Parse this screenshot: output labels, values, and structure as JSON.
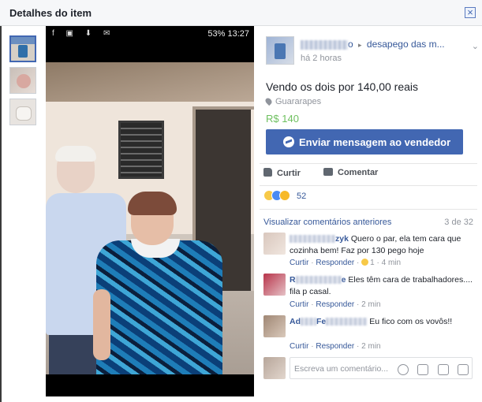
{
  "dialog": {
    "title": "Detalhes do item",
    "close_icon": "close-icon",
    "close_glyph": "×"
  },
  "photo": {
    "status_bar": {
      "left_icons": "f ▣ ⬇ ✉",
      "right": "53% 13:27"
    }
  },
  "seller": {
    "name_suffix": "o",
    "arrow": "▸",
    "group": "desapego das m...",
    "time": "há 2 horas"
  },
  "item": {
    "title": "Vendo os dois por 140,00 reais",
    "location": "Guararapes",
    "price": "R$ 140"
  },
  "message_button": {
    "label": "Enviar mensagem ao vendedor",
    "icon": "messenger-icon"
  },
  "actions": {
    "like": "Curtir",
    "comment": "Comentar"
  },
  "reactions": {
    "types": [
      "haha",
      "like",
      "wow"
    ],
    "count": "52"
  },
  "comments_header": {
    "previous": "Visualizar comentários anteriores",
    "count": "3 de 32"
  },
  "comments": [
    {
      "name_suffix": "zyk",
      "text": "Quero o par, ela tem cara que cozinha bem! Faz por 130 pego hoje",
      "like": "Curtir",
      "reply": "Responder",
      "reactions": "1",
      "time": "4 min"
    },
    {
      "name_prefix": "R",
      "name_suffix": "e",
      "text": "Eles têm cara de trabalhadores.... fila p casal.",
      "like": "Curtir",
      "reply": "Responder",
      "time": "2 min"
    },
    {
      "name_prefix": "Ad",
      "name_suffix": "Fe",
      "text": "Eu fico com os vovôs!!",
      "like": "Curtir",
      "reply": "Responder",
      "time": "2 min"
    }
  ],
  "compose": {
    "placeholder": "Escreva um comentário...",
    "tools": [
      "emoji-icon",
      "camera-icon",
      "gif-icon",
      "sticker-icon"
    ]
  },
  "colors": {
    "brand": "#4267b2",
    "link": "#365899",
    "price": "#6ec05f",
    "muted": "#90949c"
  }
}
